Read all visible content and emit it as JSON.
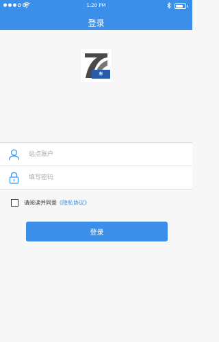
{
  "status_bar": {
    "time": "1:20 PM",
    "signal_bars": 3,
    "battery_level": 0.75
  },
  "header": {
    "title": "登录"
  },
  "logo": {
    "tag_text": "车 "
  },
  "form": {
    "account_placeholder": "站点账户",
    "password_placeholder": "填写密码"
  },
  "agreement": {
    "prefix": "请阅读并同意",
    "link": "《隐私协议》",
    "checked": false
  },
  "login_button": {
    "label": "登录"
  },
  "colors": {
    "primary": "#3b8fe9",
    "logo_dark": "#4a4a4a",
    "logo_blue": "#2a5aa6"
  }
}
